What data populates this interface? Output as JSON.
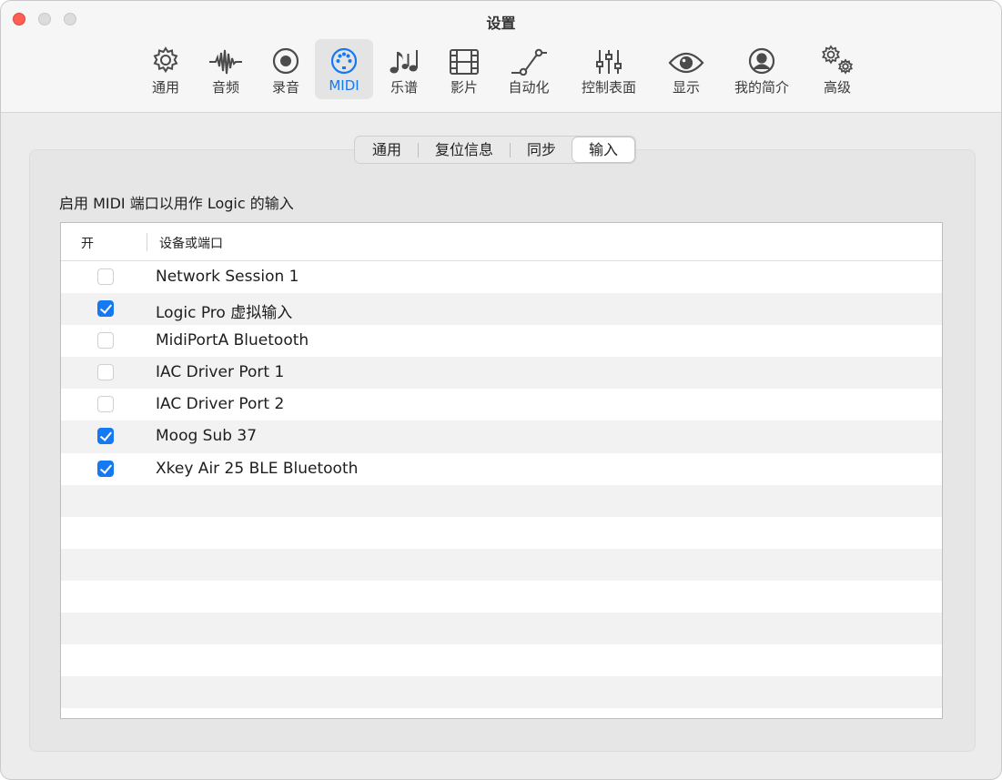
{
  "window": {
    "title": "设置"
  },
  "toolbar": {
    "selected": "MIDI",
    "items": [
      {
        "label": "通用",
        "icon": "gear-icon"
      },
      {
        "label": "音频",
        "icon": "waveform-icon"
      },
      {
        "label": "录音",
        "icon": "record-icon"
      },
      {
        "label": "MIDI",
        "icon": "midi-port-icon"
      },
      {
        "label": "乐谱",
        "icon": "music-notes-icon"
      },
      {
        "label": "影片",
        "icon": "film-icon"
      },
      {
        "label": "自动化",
        "icon": "automation-curve-icon"
      },
      {
        "label": "控制表面",
        "icon": "sliders-icon"
      },
      {
        "label": "显示",
        "icon": "eye-icon"
      },
      {
        "label": "我的简介",
        "icon": "person-circle-icon"
      },
      {
        "label": "高级",
        "icon": "gears-icon"
      }
    ]
  },
  "tabs": {
    "items": [
      "通用",
      "复位信息",
      "同步",
      "输入"
    ],
    "active": "输入"
  },
  "section_label": "启用 MIDI 端口以用作 Logic 的输入",
  "table": {
    "columns": {
      "on": "开",
      "device": "设备或端口"
    },
    "rows": [
      {
        "enabled": false,
        "name": "Network Session 1"
      },
      {
        "enabled": true,
        "name": "Logic Pro 虚拟输入"
      },
      {
        "enabled": false,
        "name": "MidiPortA Bluetooth"
      },
      {
        "enabled": false,
        "name": "IAC Driver Port 1"
      },
      {
        "enabled": false,
        "name": "IAC Driver Port 2"
      },
      {
        "enabled": true,
        "name": "Moog Sub 37"
      },
      {
        "enabled": true,
        "name": "Xkey Air 25 BLE Bluetooth"
      }
    ],
    "empty_rows": 7
  },
  "colors": {
    "accent": "#1479f2",
    "close": "#ff5f57"
  }
}
